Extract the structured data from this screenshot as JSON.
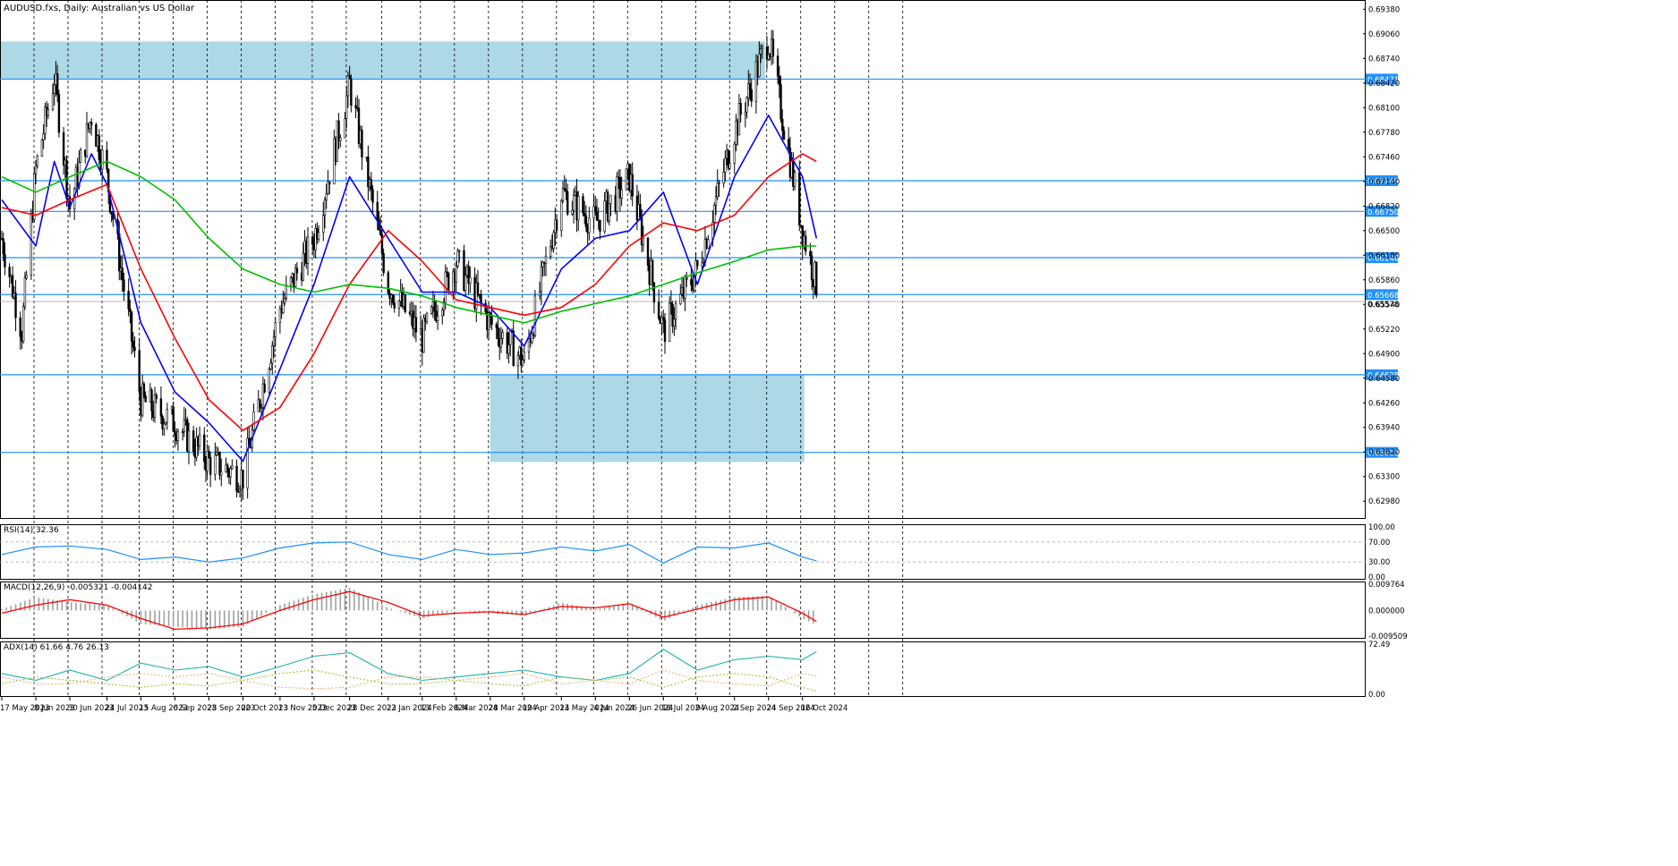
{
  "header": {
    "symbol": "AUDUSD.fxs",
    "timeframe": "Daily",
    "description": "Australian vs US Dollar",
    "title_text": "AUDUSD.fxs, Daily:  Australian vs US Dollar"
  },
  "colors": {
    "background": "#ffffff",
    "candle": "#000000",
    "grid": "#000000",
    "zone": "#add8e6",
    "level_line": "#1e90ff",
    "ma_fast": "#0000ff",
    "ma_mid": "#ff0000",
    "ma_slow": "#00c000",
    "rsi_line": "#1e90ff",
    "macd_signal": "#ff0000",
    "macd_hist": "#a0a0a0",
    "adx_main": "#20b2aa",
    "adx_plus": "#9acd32",
    "adx_minus": "#f0b070"
  },
  "chart_data": [
    {
      "type": "candlestick",
      "panel": "price",
      "ylim": [
        0.6275,
        0.695
      ],
      "price_ticks": [
        "0.69380",
        "0.69060",
        "0.68740",
        "0.68420",
        "0.68100",
        "0.67780",
        "0.67460",
        "0.67140",
        "0.66820",
        "0.66500",
        "0.66180",
        "0.65860",
        "0.65540",
        "0.65220",
        "0.64900",
        "0.64580",
        "0.64260",
        "0.63940",
        "0.63620",
        "0.63300",
        "0.62980"
      ],
      "date_labels": [
        "17 May 2023",
        "8 Jun 2023",
        "30 Jun 2023",
        "24 Jul 2023",
        "15 Aug 2023",
        "6 Sep 2023",
        "28 Sep 2023",
        "20 Oct 2023",
        "13 Nov 2023",
        "5 Dec 2023",
        "28 Dec 2023",
        "22 Jan 2024",
        "13 Feb 2024",
        "6 Mar 2024",
        "28 Mar 2024",
        "19 Apr 2024",
        "13 May 2024",
        "4 Jun 2024",
        "26 Jun 2024",
        "18 Jul 2024",
        "9 Aug 2024",
        "2 Sep 2024",
        "24 Sep 2024",
        "16 Oct 2024"
      ],
      "levels": [
        {
          "value": 0.68471,
          "label": "0.68471"
        },
        {
          "value": 0.67149,
          "label": "0.67149"
        },
        {
          "value": 0.6675,
          "label": "0.66750"
        },
        {
          "value": 0.66148,
          "label": "0.66148"
        },
        {
          "value": 0.65668,
          "label": "0.65668"
        },
        {
          "value": 0.64625,
          "label": "0.64625"
        },
        {
          "value": 0.63615,
          "label": "0.63615"
        }
      ],
      "current_price": {
        "value": 0.65578,
        "label": "0.65578"
      },
      "zones": [
        {
          "from_date": "17 May 2023",
          "to_date": "24 Sep 2024",
          "low": 0.68471,
          "high": 0.6896
        },
        {
          "from_date": "28 Mar 2024",
          "to_date": "16 Oct 2024",
          "low": 0.6349,
          "high": 0.64625
        }
      ],
      "price_path": {
        "dates": [
          "17 May 2023",
          "30 May 2023",
          "8 Jun 2023",
          "20 Jun 2023",
          "30 Jun 2023",
          "14 Jul 2023",
          "24 Jul 2023",
          "15 Aug 2023",
          "6 Sep 2023",
          "28 Sep 2023",
          "20 Oct 2023",
          "13 Nov 2023",
          "5 Dec 2023",
          "28 Dec 2023",
          "22 Jan 2024",
          "13 Feb 2024",
          "6 Mar 2024",
          "28 Mar 2024",
          "19 Apr 2024",
          "13 May 2024",
          "4 Jun 2024",
          "26 Jun 2024",
          "18 Jul 2024",
          "9 Aug 2024",
          "2 Sep 2024",
          "24 Sep 2024",
          "16 Oct 2024",
          "25 Oct 2024"
        ],
        "close": [
          0.664,
          0.652,
          0.673,
          0.685,
          0.668,
          0.68,
          0.672,
          0.643,
          0.64,
          0.635,
          0.633,
          0.655,
          0.664,
          0.684,
          0.658,
          0.651,
          0.661,
          0.653,
          0.648,
          0.67,
          0.666,
          0.672,
          0.652,
          0.66,
          0.678,
          0.69,
          0.665,
          0.658
        ]
      },
      "moving_averages": [
        {
          "period": "fast",
          "dates": [
            "17 May 2023",
            "8 Jun 2023",
            "20 Jun 2023",
            "30 Jun 2023",
            "14 Jul 2023",
            "24 Jul 2023",
            "15 Aug 2023",
            "6 Sep 2023",
            "28 Sep 2023",
            "20 Oct 2023",
            "13 Nov 2023",
            "5 Dec 2023",
            "28 Dec 2023",
            "22 Jan 2024",
            "13 Feb 2024",
            "6 Mar 2024",
            "28 Mar 2024",
            "19 Apr 2024",
            "13 May 2024",
            "4 Jun 2024",
            "26 Jun 2024",
            "18 Jul 2024",
            "9 Aug 2024",
            "2 Sep 2024",
            "24 Sep 2024",
            "16 Oct 2024",
            "25 Oct 2024"
          ],
          "values": [
            0.669,
            0.663,
            0.674,
            0.668,
            0.675,
            0.671,
            0.653,
            0.644,
            0.64,
            0.635,
            0.647,
            0.658,
            0.672,
            0.664,
            0.657,
            0.657,
            0.655,
            0.65,
            0.66,
            0.664,
            0.665,
            0.67,
            0.658,
            0.672,
            0.68,
            0.672,
            0.664
          ]
        },
        {
          "period": "mid",
          "dates": [
            "17 May 2023",
            "8 Jun 2023",
            "30 Jun 2023",
            "24 Jul 2023",
            "15 Aug 2023",
            "6 Sep 2023",
            "28 Sep 2023",
            "20 Oct 2023",
            "13 Nov 2023",
            "5 Dec 2023",
            "28 Dec 2023",
            "22 Jan 2024",
            "13 Feb 2024",
            "6 Mar 2024",
            "28 Mar 2024",
            "19 Apr 2024",
            "13 May 2024",
            "4 Jun 2024",
            "26 Jun 2024",
            "18 Jul 2024",
            "9 Aug 2024",
            "2 Sep 2024",
            "24 Sep 2024",
            "16 Oct 2024",
            "25 Oct 2024"
          ],
          "values": [
            0.668,
            0.667,
            0.669,
            0.671,
            0.66,
            0.651,
            0.643,
            0.639,
            0.642,
            0.649,
            0.658,
            0.665,
            0.661,
            0.656,
            0.655,
            0.654,
            0.655,
            0.658,
            0.663,
            0.666,
            0.665,
            0.667,
            0.672,
            0.675,
            0.674
          ]
        },
        {
          "period": "slow",
          "dates": [
            "17 May 2023",
            "8 Jun 2023",
            "30 Jun 2023",
            "24 Jul 2023",
            "15 Aug 2023",
            "6 Sep 2023",
            "28 Sep 2023",
            "20 Oct 2023",
            "13 Nov 2023",
            "5 Dec 2023",
            "28 Dec 2023",
            "22 Jan 2024",
            "13 Feb 2024",
            "6 Mar 2024",
            "28 Mar 2024",
            "19 Apr 2024",
            "13 May 2024",
            "4 Jun 2024",
            "26 Jun 2024",
            "18 Jul 2024",
            "9 Aug 2024",
            "2 Sep 2024",
            "24 Sep 2024",
            "16 Oct 2024",
            "25 Oct 2024"
          ],
          "values": [
            0.672,
            0.67,
            0.672,
            0.674,
            0.672,
            0.669,
            0.664,
            0.66,
            0.658,
            0.657,
            0.658,
            0.6575,
            0.6565,
            0.655,
            0.654,
            0.653,
            0.6545,
            0.6555,
            0.6565,
            0.658,
            0.6595,
            0.661,
            0.6625,
            0.663,
            0.663
          ]
        }
      ]
    },
    {
      "type": "line",
      "panel": "rsi",
      "label": "RSI(14) 32.36",
      "ylim": [
        0,
        100
      ],
      "ticks": [
        "100.00",
        "70.00",
        "30.00",
        "0.00"
      ],
      "levels": [
        70,
        30
      ],
      "dates": [
        "17 May 2023",
        "8 Jun 2023",
        "30 Jun 2023",
        "24 Jul 2023",
        "15 Aug 2023",
        "6 Sep 2023",
        "28 Sep 2023",
        "20 Oct 2023",
        "13 Nov 2023",
        "5 Dec 2023",
        "28 Dec 2023",
        "22 Jan 2024",
        "13 Feb 2024",
        "6 Mar 2024",
        "28 Mar 2024",
        "19 Apr 2024",
        "13 May 2024",
        "4 Jun 2024",
        "26 Jun 2024",
        "18 Jul 2024",
        "9 Aug 2024",
        "2 Sep 2024",
        "24 Sep 2024",
        "16 Oct 2024",
        "25 Oct 2024"
      ],
      "values": [
        45,
        60,
        62,
        55,
        35,
        40,
        30,
        38,
        58,
        68,
        70,
        45,
        35,
        55,
        45,
        48,
        60,
        52,
        65,
        28,
        60,
        58,
        68,
        40,
        32.36
      ]
    },
    {
      "type": "bar+line",
      "panel": "macd",
      "label": "MACD(12,26,9) -0.005321 -0.004142",
      "ylim": [
        -0.009509,
        0.009764
      ],
      "ticks": [
        "0.009764",
        "0.000000",
        "-0.009509"
      ],
      "dates": [
        "17 May 2023",
        "8 Jun 2023",
        "30 Jun 2023",
        "24 Jul 2023",
        "15 Aug 2023",
        "6 Sep 2023",
        "28 Sep 2023",
        "20 Oct 2023",
        "13 Nov 2023",
        "5 Dec 2023",
        "28 Dec 2023",
        "22 Jan 2024",
        "13 Feb 2024",
        "6 Mar 2024",
        "28 Mar 2024",
        "19 Apr 2024",
        "13 May 2024",
        "4 Jun 2024",
        "26 Jun 2024",
        "18 Jul 2024",
        "9 Aug 2024",
        "2 Sep 2024",
        "24 Sep 2024",
        "16 Oct 2024",
        "25 Oct 2024"
      ],
      "histogram": [
        0.0005,
        0.005,
        0.003,
        0.002,
        -0.005,
        -0.006,
        -0.007,
        -0.006,
        0.002,
        0.006,
        0.0085,
        0.001,
        -0.003,
        0.0,
        -0.001,
        -0.002,
        0.003,
        0.0005,
        0.003,
        -0.004,
        0.002,
        0.005,
        0.0055,
        -0.003,
        -0.0053
      ],
      "signal": [
        -0.001,
        0.002,
        0.004,
        0.002,
        -0.003,
        -0.007,
        -0.0065,
        -0.005,
        0.0,
        0.004,
        0.007,
        0.003,
        -0.002,
        -0.001,
        -0.0005,
        -0.0015,
        0.0015,
        0.001,
        0.0025,
        -0.0025,
        0.0005,
        0.004,
        0.005,
        -0.001,
        -0.0041
      ]
    },
    {
      "type": "line",
      "panel": "adx",
      "label": "ADX(14) 61.66 4.76 26.13",
      "ylim": [
        0,
        72.49
      ],
      "ticks": [
        "72.49",
        "0.00"
      ],
      "dates": [
        "17 May 2023",
        "8 Jun 2023",
        "30 Jun 2023",
        "24 Jul 2023",
        "15 Aug 2023",
        "6 Sep 2023",
        "28 Sep 2023",
        "20 Oct 2023",
        "13 Nov 2023",
        "5 Dec 2023",
        "28 Dec 2023",
        "22 Jan 2024",
        "13 Feb 2024",
        "6 Mar 2024",
        "28 Mar 2024",
        "19 Apr 2024",
        "13 May 2024",
        "4 Jun 2024",
        "26 Jun 2024",
        "18 Jul 2024",
        "9 Aug 2024",
        "2 Sep 2024",
        "24 Sep 2024",
        "16 Oct 2024",
        "25 Oct 2024"
      ],
      "series": [
        {
          "name": "ADX",
          "values": [
            30,
            20,
            35,
            20,
            45,
            35,
            40,
            25,
            40,
            55,
            60,
            30,
            20,
            25,
            30,
            35,
            25,
            20,
            30,
            65,
            35,
            50,
            55,
            50,
            61.66
          ]
        },
        {
          "name": "+DI",
          "values": [
            15,
            25,
            20,
            15,
            10,
            15,
            12,
            20,
            30,
            35,
            25,
            15,
            15,
            20,
            15,
            12,
            25,
            20,
            25,
            10,
            25,
            30,
            25,
            10,
            4.76
          ]
        },
        {
          "name": "-DI",
          "values": [
            25,
            15,
            15,
            25,
            30,
            25,
            30,
            20,
            10,
            8,
            10,
            25,
            25,
            20,
            25,
            30,
            15,
            20,
            15,
            35,
            20,
            15,
            12,
            30,
            26.13
          ]
        }
      ]
    }
  ]
}
